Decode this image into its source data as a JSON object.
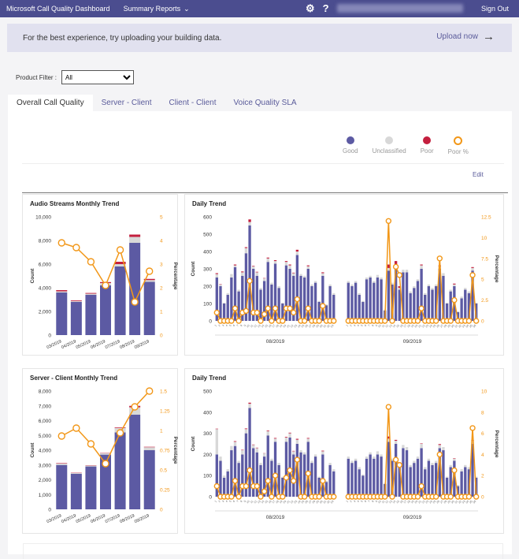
{
  "topbar": {
    "brand": "Microsoft Call Quality Dashboard",
    "menu": "Summary Reports",
    "signout": "Sign Out"
  },
  "banner": {
    "message": "For the best experience, try uploading your building data.",
    "upload": "Upload now"
  },
  "filter": {
    "label": "Product Filter :",
    "value": "All"
  },
  "tabs": [
    "Overall Call Quality",
    "Server - Client",
    "Client - Client",
    "Voice Quality SLA"
  ],
  "legend": {
    "good": "Good",
    "unclassified": "Unclassified",
    "poor": "Poor",
    "poor_pct": "Poor %"
  },
  "edit": "Edit",
  "colors": {
    "good": "#5c5aa3",
    "unclassified": "#d8d8d8",
    "poor": "#c41f3e",
    "poor_pct": "#f29718"
  },
  "chart_data": [
    {
      "type": "bar",
      "title": "Audio Streams Monthly Trend",
      "categories": [
        "03/2019",
        "04/2019",
        "05/2019",
        "06/2019",
        "07/2019",
        "08/2019",
        "09/2019"
      ],
      "series": [
        {
          "name": "Good",
          "values": [
            3600,
            2800,
            3400,
            4200,
            5800,
            7800,
            4500
          ]
        },
        {
          "name": "Unclassified",
          "values": [
            100,
            80,
            100,
            200,
            200,
            500,
            150
          ]
        },
        {
          "name": "Poor",
          "values": [
            100,
            60,
            60,
            80,
            200,
            200,
            100
          ]
        },
        {
          "name": "Poor %",
          "values": [
            3.9,
            3.7,
            3.1,
            2.1,
            3.6,
            1.4,
            2.7
          ]
        }
      ],
      "ylabel": "Count",
      "y2label": "Percentage",
      "yticks": [
        "0",
        "2,000",
        "4,000",
        "6,000",
        "8,000",
        "10,000"
      ],
      "y2ticks": [
        "0",
        "1",
        "2",
        "3",
        "4",
        "5"
      ],
      "ylim": [
        0,
        10000
      ],
      "y2lim": [
        0,
        5
      ]
    },
    {
      "type": "bar",
      "title": "Daily Trend",
      "groups": [
        "08/2019",
        "09/2019"
      ],
      "series": [
        {
          "name": "Good",
          "values": [
            [
              250,
              200,
              100,
              150,
              250,
              310,
              170,
              260,
              390,
              550,
              300,
              260,
              180,
              230,
              340,
              210,
              330,
              190,
              100,
              320,
              300,
              260,
              380,
              260,
              250,
              300,
              200,
              220,
              110,
              260,
              90,
              200,
              150
            ],
            [
              220,
              200,
              220,
              150,
              110,
              240,
              250,
              220,
              250,
              240,
              60,
              290,
              210,
              310,
              180,
              280,
              280,
              160,
              190,
              230,
              300,
              150,
              200,
              180,
              200,
              300,
              260,
              100,
              170,
              200,
              50,
              130,
              180,
              160,
              290,
              100
            ]
          ]
        },
        {
          "name": "Unclassified",
          "values": [
            [
              20,
              10,
              5,
              10,
              20,
              10,
              10,
              20,
              30,
              20,
              15,
              20,
              10,
              15,
              20,
              10,
              15,
              10,
              5,
              20,
              20,
              15,
              20,
              10,
              10,
              15,
              10,
              10,
              5,
              15,
              5,
              10,
              10
            ],
            [
              10,
              10,
              10,
              10,
              5,
              10,
              10,
              10,
              15,
              10,
              5,
              15,
              10,
              15,
              10,
              15,
              15,
              10,
              10,
              10,
              20,
              10,
              10,
              10,
              10,
              15,
              15,
              5,
              10,
              10,
              5,
              10,
              10,
              10,
              15,
              5
            ]
          ]
        },
        {
          "name": "Poor",
          "values": [
            [
              5,
              2,
              0,
              0,
              0,
              5,
              0,
              5,
              5,
              15,
              3,
              3,
              0,
              2,
              5,
              0,
              5,
              0,
              0,
              5,
              5,
              3,
              10,
              0,
              0,
              5,
              0,
              0,
              0,
              5,
              0,
              0,
              0
            ],
            [
              0,
              0,
              0,
              0,
              0,
              0,
              0,
              0,
              0,
              0,
              0,
              20,
              0,
              20,
              10,
              0,
              0,
              0,
              0,
              0,
              5,
              0,
              0,
              0,
              0,
              5,
              0,
              0,
              0,
              5,
              0,
              0,
              0,
              0,
              5,
              0
            ]
          ]
        },
        {
          "name": "Poor %",
          "values": [
            [
              1,
              0,
              0,
              0,
              0,
              1.5,
              0,
              1,
              1.2,
              4.8,
              1,
              1,
              0,
              0.8,
              1.5,
              0,
              1.5,
              0,
              0,
              1.5,
              1.5,
              1,
              2.6,
              0,
              0,
              1.5,
              0,
              0,
              0,
              1.8,
              0,
              0,
              0
            ],
            [
              0,
              0,
              0,
              0,
              0,
              0,
              0,
              0,
              0,
              0,
              0,
              12,
              0,
              6.5,
              5.5,
              0,
              0,
              0,
              0,
              0,
              1.5,
              0,
              0,
              0,
              0,
              7.5,
              0,
              0,
              0,
              2.5,
              0,
              0,
              0,
              0,
              5.5,
              0
            ]
          ]
        }
      ],
      "ylabel": "Count",
      "y2label": "Percentage",
      "yticks": [
        "0",
        "100",
        "200",
        "300",
        "400",
        "500",
        "600"
      ],
      "y2ticks": [
        "0",
        "2.5",
        "5",
        "7.5",
        "10",
        "12.5"
      ],
      "ylim": [
        0,
        600
      ],
      "y2lim": [
        0,
        12.5
      ]
    },
    {
      "type": "bar",
      "title": "Server - Client Monthly Trend",
      "categories": [
        "03/2019",
        "04/2019",
        "05/2019",
        "06/2019",
        "07/2019",
        "08/2019",
        "09/2019"
      ],
      "series": [
        {
          "name": "Good",
          "values": [
            3000,
            2400,
            2900,
            3700,
            5200,
            6400,
            4000
          ]
        },
        {
          "name": "Unclassified",
          "values": [
            100,
            60,
            60,
            100,
            300,
            500,
            200
          ]
        },
        {
          "name": "Poor",
          "values": [
            30,
            20,
            20,
            20,
            40,
            100,
            30
          ]
        },
        {
          "name": "Poor %",
          "values": [
            0.93,
            1.03,
            0.83,
            0.58,
            0.97,
            1.3,
            1.5
          ]
        }
      ],
      "ylabel": "Count",
      "y2label": "Percentage",
      "yticks": [
        "0",
        "1,000",
        "2,000",
        "3,000",
        "4,000",
        "5,000",
        "6,000",
        "7,000",
        "8,000"
      ],
      "y2ticks": [
        "0",
        "0.25",
        "0.5",
        "0.75",
        "1",
        "1.25",
        "1.5"
      ],
      "ylim": [
        0,
        8000
      ],
      "y2lim": [
        0,
        1.5
      ]
    },
    {
      "type": "bar",
      "title": "Daily Trend",
      "groups": [
        "08/2019",
        "09/2019"
      ],
      "series": [
        {
          "name": "Good",
          "values": [
            [
              200,
              170,
              90,
              120,
              220,
              240,
              160,
              200,
              300,
              420,
              230,
              210,
              150,
              190,
              290,
              170,
              260,
              150,
              90,
              260,
              280,
              200,
              250,
              210,
              200,
              260,
              160,
              190,
              90,
              200,
              70,
              150,
              120
            ],
            [
              180,
              160,
              170,
              130,
              100,
              180,
              200,
              180,
              200,
              190,
              60,
              260,
              170,
              250,
              150,
              230,
              220,
              140,
              160,
              180,
              230,
              130,
              170,
              150,
              160,
              230,
              220,
              90,
              140,
              170,
              50,
              120,
              140,
              130,
              250,
              90
            ]
          ]
        },
        {
          "name": "Unclassified",
          "values": [
            [
              120,
              20,
              10,
              10,
              20,
              20,
              10,
              20,
              20,
              20,
              15,
              20,
              10,
              15,
              20,
              10,
              15,
              10,
              5,
              20,
              20,
              15,
              20,
              10,
              10,
              15,
              10,
              10,
              5,
              15,
              5,
              10,
              10
            ],
            [
              10,
              10,
              10,
              10,
              5,
              10,
              10,
              10,
              15,
              10,
              5,
              15,
              10,
              15,
              10,
              15,
              15,
              10,
              10,
              10,
              20,
              10,
              10,
              10,
              10,
              15,
              15,
              5,
              10,
              10,
              5,
              10,
              10,
              10,
              15,
              5
            ]
          ]
        },
        {
          "name": "Poor",
          "values": [
            [
              2,
              0,
              0,
              0,
              0,
              3,
              0,
              2,
              3,
              5,
              2,
              2,
              0,
              1,
              3,
              0,
              3,
              0,
              0,
              3,
              3,
              2,
              4,
              0,
              0,
              3,
              0,
              0,
              0,
              3,
              0,
              0,
              0
            ],
            [
              0,
              0,
              0,
              0,
              0,
              0,
              0,
              0,
              0,
              0,
              0,
              10,
              0,
              4,
              3,
              0,
              0,
              0,
              0,
              0,
              2,
              0,
              0,
              0,
              0,
              4,
              0,
              0,
              0,
              2,
              0,
              0,
              0,
              0,
              3,
              0
            ]
          ]
        },
        {
          "name": "Poor %",
          "values": [
            [
              1,
              0,
              0,
              0,
              0,
              1.5,
              0,
              1,
              1,
              2.5,
              1,
              1,
              0,
              0.5,
              1.5,
              0,
              2,
              0,
              0,
              1.8,
              2.5,
              1.5,
              3.5,
              0,
              0,
              2.2,
              0,
              0,
              0,
              1.5,
              0,
              0,
              0
            ],
            [
              0,
              0,
              0,
              0,
              0,
              0,
              0,
              0,
              0,
              0,
              0,
              8.5,
              0,
              3.5,
              3,
              0,
              0,
              0,
              0,
              0,
              1,
              0,
              0,
              0,
              0,
              4,
              0,
              0,
              0,
              2.5,
              0,
              0,
              0,
              0,
              6.5,
              0
            ]
          ]
        }
      ],
      "ylabel": "Count",
      "y2label": "Percentage",
      "yticks": [
        "0",
        "100",
        "200",
        "300",
        "400",
        "500"
      ],
      "y2ticks": [
        "0",
        "2",
        "4",
        "6",
        "8",
        "10"
      ],
      "ylim": [
        0,
        500
      ],
      "y2lim": [
        0,
        10
      ]
    }
  ]
}
